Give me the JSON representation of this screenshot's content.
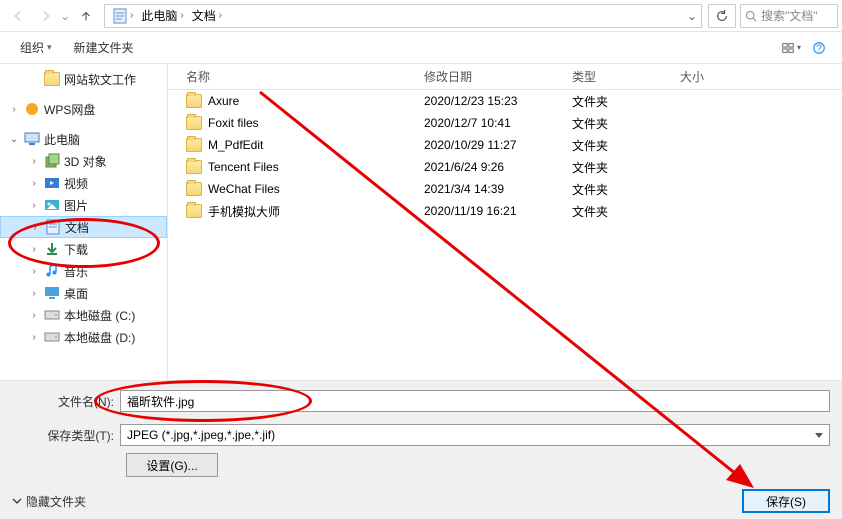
{
  "nav": {
    "breadcrumb": [
      "此电脑",
      "文档"
    ],
    "search_placeholder": "搜索\"文档\""
  },
  "toolbar": {
    "organize": "组织",
    "new_folder": "新建文件夹"
  },
  "tree": {
    "items": [
      {
        "label": "网站软文工作",
        "expand": "",
        "icon": "folder",
        "indent": 1
      },
      {
        "label": "",
        "spacer": true
      },
      {
        "label": "WPS网盘",
        "expand": "›",
        "icon": "wps",
        "indent": 0
      },
      {
        "label": "",
        "spacer": true
      },
      {
        "label": "此电脑",
        "expand": "⌄",
        "icon": "pc",
        "indent": 0
      },
      {
        "label": "3D 对象",
        "expand": "›",
        "icon": "3d",
        "indent": 1
      },
      {
        "label": "视频",
        "expand": "›",
        "icon": "video",
        "indent": 1
      },
      {
        "label": "图片",
        "expand": "›",
        "icon": "pictures",
        "indent": 1
      },
      {
        "label": "文档",
        "expand": "›",
        "icon": "doc",
        "indent": 1,
        "selected": true
      },
      {
        "label": "下载",
        "expand": "›",
        "icon": "download",
        "indent": 1
      },
      {
        "label": "音乐",
        "expand": "›",
        "icon": "music",
        "indent": 1
      },
      {
        "label": "桌面",
        "expand": "›",
        "icon": "desktop",
        "indent": 1
      },
      {
        "label": "本地磁盘 (C:)",
        "expand": "›",
        "icon": "disk",
        "indent": 1
      },
      {
        "label": "本地磁盘 (D:)",
        "expand": "›",
        "icon": "disk",
        "indent": 1
      }
    ]
  },
  "filelist": {
    "columns": {
      "name": "名称",
      "date": "修改日期",
      "type": "类型",
      "size": "大小"
    },
    "rows": [
      {
        "name": "Axure",
        "date": "2020/12/23 15:23",
        "type": "文件夹"
      },
      {
        "name": "Foxit files",
        "date": "2020/12/7 10:41",
        "type": "文件夹"
      },
      {
        "name": "M_PdfEdit",
        "date": "2020/10/29 11:27",
        "type": "文件夹"
      },
      {
        "name": "Tencent Files",
        "date": "2021/6/24 9:26",
        "type": "文件夹"
      },
      {
        "name": "WeChat Files",
        "date": "2021/3/4 14:39",
        "type": "文件夹"
      },
      {
        "name": "手机模拟大师",
        "date": "2020/11/19 16:21",
        "type": "文件夹"
      }
    ]
  },
  "form": {
    "filename_label": "文件名(N):",
    "filename_value": "福昕软件.jpg",
    "filetype_label": "保存类型(T):",
    "filetype_value": "JPEG (*.jpg,*.jpeg,*.jpe,*.jif)",
    "settings": "设置(G)...",
    "hide_folders": "隐藏文件夹",
    "save": "保存(S)"
  },
  "icon_colors": {
    "wps": "#f5a623",
    "video": "#3a7bd5",
    "pictures": "#3ab0d5",
    "download": "#2e8b57",
    "music": "#1e90ff",
    "desktop": "#4aa3df",
    "disk": "#888",
    "3d": "#5b8a3c",
    "doc": "#3a7bd5",
    "pc": "#3a7bd5"
  }
}
